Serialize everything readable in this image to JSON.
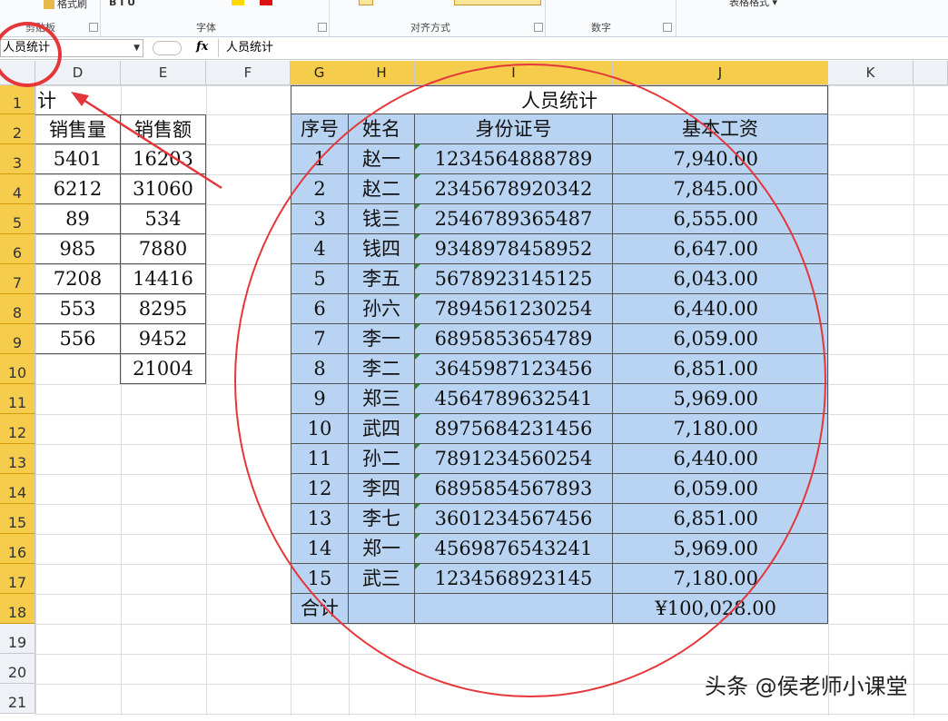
{
  "ribbon": {
    "tool_format_painter": "格式刷",
    "tool_style": "表格格式",
    "groups": [
      "剪贴板",
      "字体",
      "对齐方式",
      "数字"
    ]
  },
  "formula_bar": {
    "name_box": "人员统计",
    "fx": "fx",
    "content": "人员统计"
  },
  "columns": [
    "D",
    "E",
    "F",
    "G",
    "H",
    "I",
    "J",
    "K"
  ],
  "rows": [
    "1",
    "2",
    "3",
    "4",
    "5",
    "6",
    "7",
    "8",
    "9",
    "10",
    "11",
    "12",
    "13",
    "14",
    "15",
    "16",
    "17",
    "18",
    "19",
    "20",
    "21"
  ],
  "left_table": {
    "title_fragment": "计",
    "headers": [
      "销售量",
      "销售额"
    ],
    "rows": [
      [
        "5401",
        "16203"
      ],
      [
        "6212",
        "31060"
      ],
      [
        "89",
        "534"
      ],
      [
        "985",
        "7880"
      ],
      [
        "7208",
        "14416"
      ],
      [
        "553",
        "8295"
      ],
      [
        "556",
        "9452"
      ],
      [
        "",
        "21004"
      ]
    ]
  },
  "main_table": {
    "title": "人员统计",
    "headers": [
      "序号",
      "姓名",
      "身份证号",
      "基本工资"
    ],
    "rows": [
      [
        "1",
        "赵一",
        "1234564888789",
        "7,940.00"
      ],
      [
        "2",
        "赵二",
        "2345678920342",
        "7,845.00"
      ],
      [
        "3",
        "钱三",
        "2546789365487",
        "6,555.00"
      ],
      [
        "4",
        "钱四",
        "9348978458952",
        "6,647.00"
      ],
      [
        "5",
        "李五",
        "5678923145125",
        "6,043.00"
      ],
      [
        "6",
        "孙六",
        "7894561230254",
        "6,440.00"
      ],
      [
        "7",
        "李一",
        "6895853654789",
        "6,059.00"
      ],
      [
        "8",
        "李二",
        "3645987123456",
        "6,851.00"
      ],
      [
        "9",
        "郑三",
        "4564789632541",
        "5,969.00"
      ],
      [
        "10",
        "武四",
        "8975684231456",
        "7,180.00"
      ],
      [
        "11",
        "孙二",
        "7891234560254",
        "6,440.00"
      ],
      [
        "12",
        "李四",
        "6895854567893",
        "6,059.00"
      ],
      [
        "13",
        "李七",
        "3601234567456",
        "6,851.00"
      ],
      [
        "14",
        "郑一",
        "4569876543241",
        "5,969.00"
      ],
      [
        "15",
        "武三",
        "1234568923145",
        "7,180.00"
      ]
    ],
    "total_label": "合计",
    "total_value": "¥100,028.00"
  },
  "watermark": "头条 @侯老师小课堂",
  "colors": {
    "selection": "#b8d4f2",
    "header_highlight": "#f6cc4d",
    "annotation": "#e5363a"
  }
}
